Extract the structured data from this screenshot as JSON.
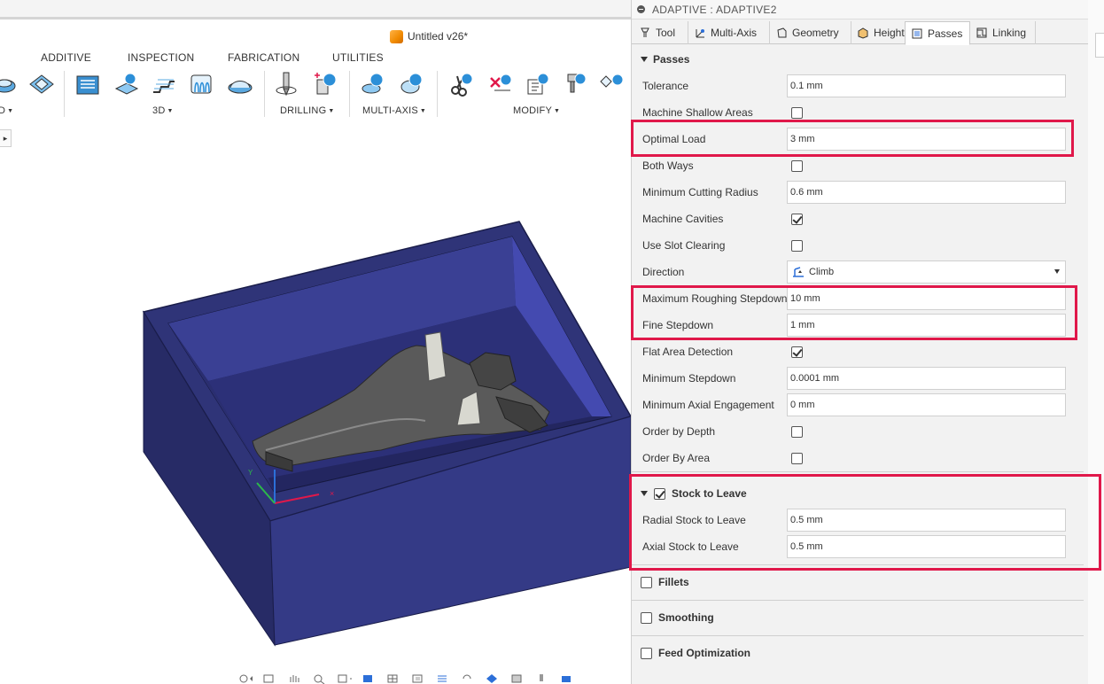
{
  "document": {
    "title": "Untitled v26*"
  },
  "workspace_tabs": [
    "ADDITIVE",
    "INSPECTION",
    "FABRICATION",
    "UTILITIES"
  ],
  "ribbon_groups": {
    "first": "D",
    "three_d": "3D",
    "drilling": "DRILLING",
    "multi_axis": "MULTI-AXIS",
    "modify": "MODIFY"
  },
  "panel": {
    "title": "ADAPTIVE : ADAPTIVE2",
    "tabs": [
      "Tool",
      "Multi-Axis",
      "Geometry",
      "Heights",
      "Passes",
      "Linking"
    ],
    "active_tab": "Passes",
    "section_title": "Passes",
    "rows": [
      {
        "label": "Tolerance",
        "type": "text",
        "value": "0.1 mm"
      },
      {
        "label": "Machine Shallow Areas",
        "type": "checkbox",
        "checked": false
      },
      {
        "label": "Optimal Load",
        "type": "text",
        "value": "3 mm"
      },
      {
        "label": "Both Ways",
        "type": "checkbox",
        "checked": false
      },
      {
        "label": "Minimum Cutting Radius",
        "type": "text",
        "value": "0.6 mm"
      },
      {
        "label": "Machine Cavities",
        "type": "checkbox",
        "checked": true
      },
      {
        "label": "Use Slot Clearing",
        "type": "checkbox",
        "checked": false
      },
      {
        "label": "Direction",
        "type": "dropdown",
        "value": "Climb"
      },
      {
        "label": "Maximum Roughing Stepdown",
        "type": "text",
        "value": "10 mm"
      },
      {
        "label": "Fine Stepdown",
        "type": "text",
        "value": "1 mm"
      },
      {
        "label": "Flat Area Detection",
        "type": "checkbox",
        "checked": true
      },
      {
        "label": "Minimum Stepdown",
        "type": "text",
        "value": "0.0001 mm"
      },
      {
        "label": "Minimum Axial Engagement",
        "type": "text",
        "value": "0 mm"
      },
      {
        "label": "Order by Depth",
        "type": "checkbox",
        "checked": false
      },
      {
        "label": "Order By Area",
        "type": "checkbox",
        "checked": false
      }
    ],
    "stock_group": {
      "title": "Stock to Leave",
      "checked": true,
      "rows": [
        {
          "label": "Radial Stock to Leave",
          "value": "0.5 mm"
        },
        {
          "label": "Axial Stock to Leave",
          "value": "0.5 mm"
        }
      ]
    },
    "collapsed_groups": [
      {
        "title": "Fillets",
        "checked": false
      },
      {
        "title": "Smoothing",
        "checked": false
      },
      {
        "title": "Feed Optimization",
        "checked": false
      }
    ]
  },
  "colors": {
    "highlight": "#e0184a",
    "stock_box": "#2b2f6b",
    "part": "#4a4a4a"
  }
}
